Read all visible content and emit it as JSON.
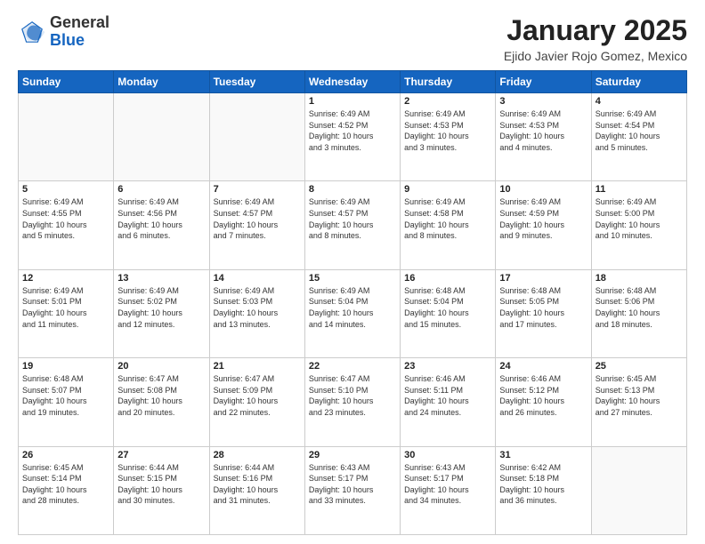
{
  "header": {
    "logo_general": "General",
    "logo_blue": "Blue",
    "month_title": "January 2025",
    "location": "Ejido Javier Rojo Gomez, Mexico"
  },
  "days_of_week": [
    "Sunday",
    "Monday",
    "Tuesday",
    "Wednesday",
    "Thursday",
    "Friday",
    "Saturday"
  ],
  "weeks": [
    [
      {
        "day": "",
        "info": ""
      },
      {
        "day": "",
        "info": ""
      },
      {
        "day": "",
        "info": ""
      },
      {
        "day": "1",
        "info": "Sunrise: 6:49 AM\nSunset: 4:52 PM\nDaylight: 10 hours\nand 3 minutes."
      },
      {
        "day": "2",
        "info": "Sunrise: 6:49 AM\nSunset: 4:53 PM\nDaylight: 10 hours\nand 3 minutes."
      },
      {
        "day": "3",
        "info": "Sunrise: 6:49 AM\nSunset: 4:53 PM\nDaylight: 10 hours\nand 4 minutes."
      },
      {
        "day": "4",
        "info": "Sunrise: 6:49 AM\nSunset: 4:54 PM\nDaylight: 10 hours\nand 5 minutes."
      }
    ],
    [
      {
        "day": "5",
        "info": "Sunrise: 6:49 AM\nSunset: 4:55 PM\nDaylight: 10 hours\nand 5 minutes."
      },
      {
        "day": "6",
        "info": "Sunrise: 6:49 AM\nSunset: 4:56 PM\nDaylight: 10 hours\nand 6 minutes."
      },
      {
        "day": "7",
        "info": "Sunrise: 6:49 AM\nSunset: 4:57 PM\nDaylight: 10 hours\nand 7 minutes."
      },
      {
        "day": "8",
        "info": "Sunrise: 6:49 AM\nSunset: 4:57 PM\nDaylight: 10 hours\nand 8 minutes."
      },
      {
        "day": "9",
        "info": "Sunrise: 6:49 AM\nSunset: 4:58 PM\nDaylight: 10 hours\nand 8 minutes."
      },
      {
        "day": "10",
        "info": "Sunrise: 6:49 AM\nSunset: 4:59 PM\nDaylight: 10 hours\nand 9 minutes."
      },
      {
        "day": "11",
        "info": "Sunrise: 6:49 AM\nSunset: 5:00 PM\nDaylight: 10 hours\nand 10 minutes."
      }
    ],
    [
      {
        "day": "12",
        "info": "Sunrise: 6:49 AM\nSunset: 5:01 PM\nDaylight: 10 hours\nand 11 minutes."
      },
      {
        "day": "13",
        "info": "Sunrise: 6:49 AM\nSunset: 5:02 PM\nDaylight: 10 hours\nand 12 minutes."
      },
      {
        "day": "14",
        "info": "Sunrise: 6:49 AM\nSunset: 5:03 PM\nDaylight: 10 hours\nand 13 minutes."
      },
      {
        "day": "15",
        "info": "Sunrise: 6:49 AM\nSunset: 5:04 PM\nDaylight: 10 hours\nand 14 minutes."
      },
      {
        "day": "16",
        "info": "Sunrise: 6:48 AM\nSunset: 5:04 PM\nDaylight: 10 hours\nand 15 minutes."
      },
      {
        "day": "17",
        "info": "Sunrise: 6:48 AM\nSunset: 5:05 PM\nDaylight: 10 hours\nand 17 minutes."
      },
      {
        "day": "18",
        "info": "Sunrise: 6:48 AM\nSunset: 5:06 PM\nDaylight: 10 hours\nand 18 minutes."
      }
    ],
    [
      {
        "day": "19",
        "info": "Sunrise: 6:48 AM\nSunset: 5:07 PM\nDaylight: 10 hours\nand 19 minutes."
      },
      {
        "day": "20",
        "info": "Sunrise: 6:47 AM\nSunset: 5:08 PM\nDaylight: 10 hours\nand 20 minutes."
      },
      {
        "day": "21",
        "info": "Sunrise: 6:47 AM\nSunset: 5:09 PM\nDaylight: 10 hours\nand 22 minutes."
      },
      {
        "day": "22",
        "info": "Sunrise: 6:47 AM\nSunset: 5:10 PM\nDaylight: 10 hours\nand 23 minutes."
      },
      {
        "day": "23",
        "info": "Sunrise: 6:46 AM\nSunset: 5:11 PM\nDaylight: 10 hours\nand 24 minutes."
      },
      {
        "day": "24",
        "info": "Sunrise: 6:46 AM\nSunset: 5:12 PM\nDaylight: 10 hours\nand 26 minutes."
      },
      {
        "day": "25",
        "info": "Sunrise: 6:45 AM\nSunset: 5:13 PM\nDaylight: 10 hours\nand 27 minutes."
      }
    ],
    [
      {
        "day": "26",
        "info": "Sunrise: 6:45 AM\nSunset: 5:14 PM\nDaylight: 10 hours\nand 28 minutes."
      },
      {
        "day": "27",
        "info": "Sunrise: 6:44 AM\nSunset: 5:15 PM\nDaylight: 10 hours\nand 30 minutes."
      },
      {
        "day": "28",
        "info": "Sunrise: 6:44 AM\nSunset: 5:16 PM\nDaylight: 10 hours\nand 31 minutes."
      },
      {
        "day": "29",
        "info": "Sunrise: 6:43 AM\nSunset: 5:17 PM\nDaylight: 10 hours\nand 33 minutes."
      },
      {
        "day": "30",
        "info": "Sunrise: 6:43 AM\nSunset: 5:17 PM\nDaylight: 10 hours\nand 34 minutes."
      },
      {
        "day": "31",
        "info": "Sunrise: 6:42 AM\nSunset: 5:18 PM\nDaylight: 10 hours\nand 36 minutes."
      },
      {
        "day": "",
        "info": ""
      }
    ]
  ]
}
